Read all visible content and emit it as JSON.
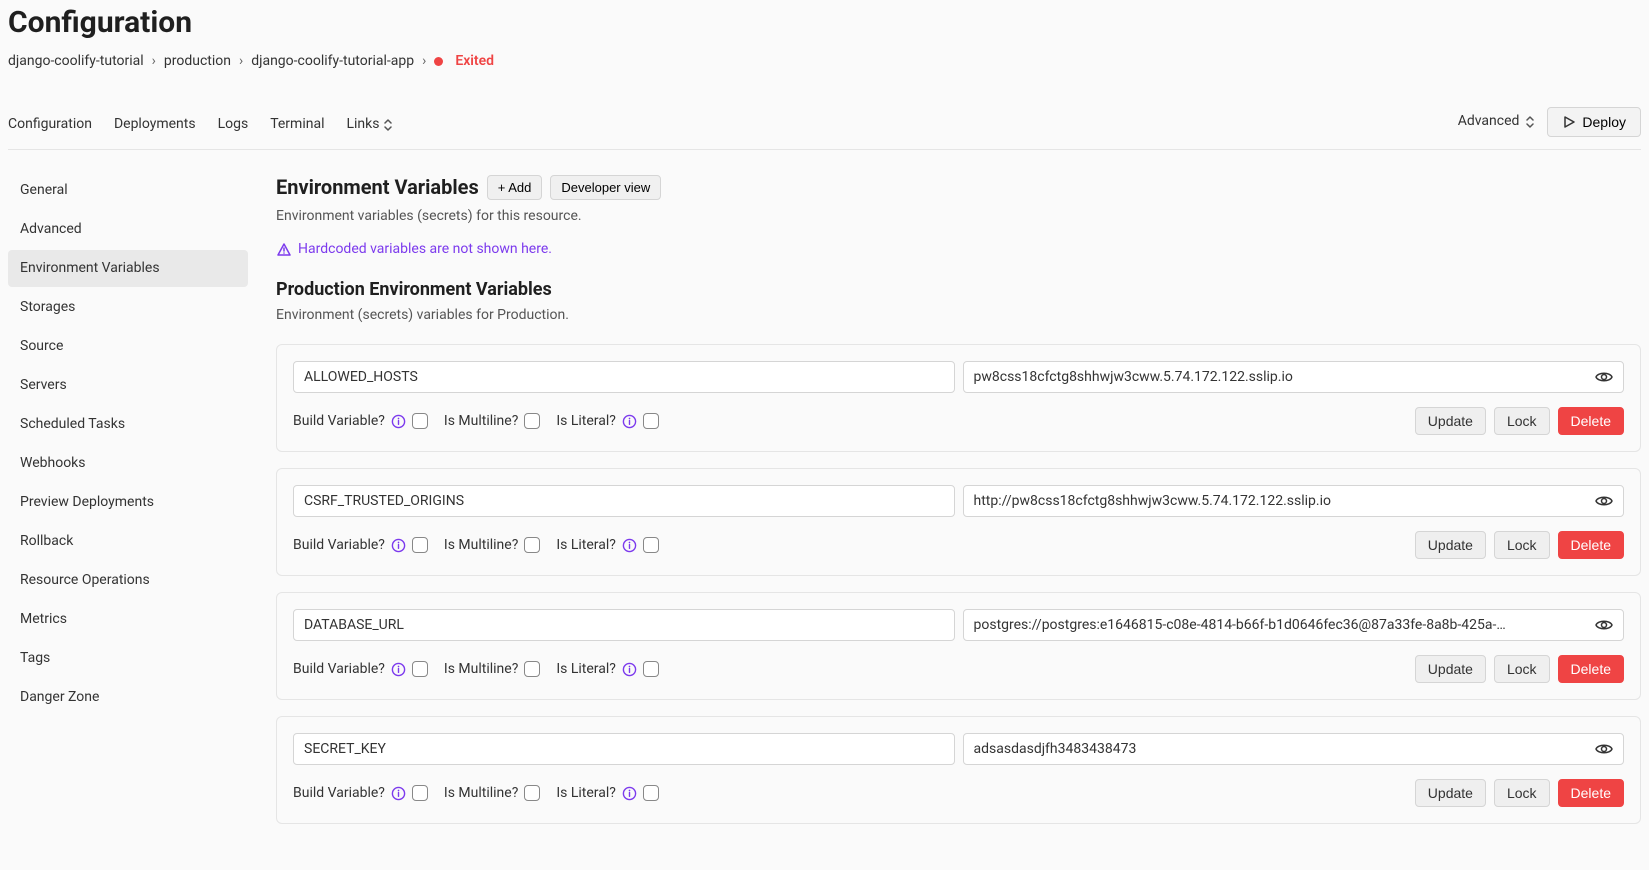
{
  "page_title": "Configuration",
  "breadcrumb": {
    "items": [
      "django-coolify-tutorial",
      "production",
      "django-coolify-tutorial-app"
    ],
    "status_label": "Exited"
  },
  "tabs": {
    "items": [
      "Configuration",
      "Deployments",
      "Logs",
      "Terminal",
      "Links"
    ]
  },
  "advanced_label": "Advanced",
  "deploy_label": "Deploy",
  "sidebar": {
    "items": [
      "General",
      "Advanced",
      "Environment Variables",
      "Storages",
      "Source",
      "Servers",
      "Scheduled Tasks",
      "Webhooks",
      "Preview Deployments",
      "Rollback",
      "Resource Operations",
      "Metrics",
      "Tags",
      "Danger Zone"
    ],
    "active_index": 2
  },
  "env_section": {
    "title": "Environment Variables",
    "add_label": "+ Add",
    "dev_view_label": "Developer view",
    "subtitle": "Environment variables (secrets) for this resource.",
    "hardcoded_warning": "Hardcoded variables are not shown here."
  },
  "prod_section": {
    "title": "Production Environment Variables",
    "subtitle": "Environment (secrets) variables for Production."
  },
  "check_labels": {
    "build": "Build Variable?",
    "multiline": "Is Multiline?",
    "literal": "Is Literal?"
  },
  "buttons": {
    "update": "Update",
    "lock": "Lock",
    "delete": "Delete"
  },
  "env_vars": [
    {
      "key": "ALLOWED_HOSTS",
      "value": "pw8css18cfctg8shhwjw3cww.5.74.172.122.sslip.io"
    },
    {
      "key": "CSRF_TRUSTED_ORIGINS",
      "value": "http://pw8css18cfctg8shhwjw3cww.5.74.172.122.sslip.io"
    },
    {
      "key": "DATABASE_URL",
      "value": "postgres://postgres:e1646815-c08e-4814-b66f-b1d0646fec36@87a33fe-8a8b-425a-…"
    },
    {
      "key": "SECRET_KEY",
      "value": "adsasdasdjfh3483438473"
    }
  ]
}
